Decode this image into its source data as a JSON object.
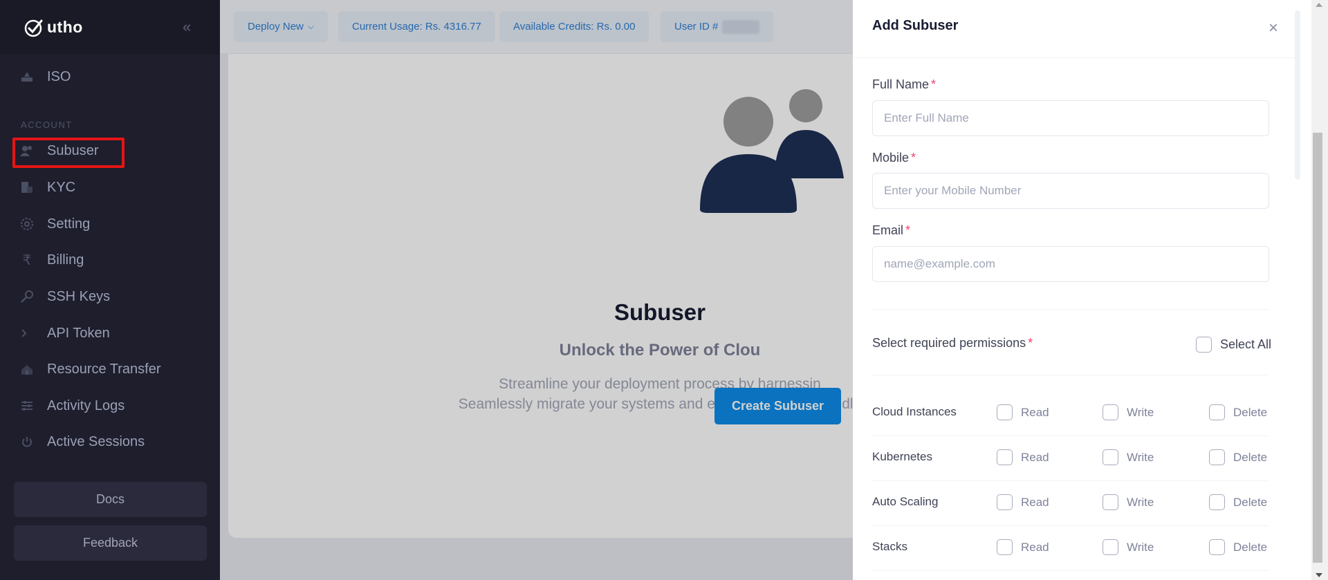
{
  "sidebar": {
    "brand": "utho",
    "collapse_icon": "double-chevron-left-icon",
    "section_account": "ACCOUNT",
    "items": [
      {
        "label": "ISO",
        "icon": "iso-icon"
      },
      {
        "label": "Subuser",
        "icon": "subuser-icon"
      },
      {
        "label": "KYC",
        "icon": "kyc-icon"
      },
      {
        "label": "Setting",
        "icon": "gear-icon"
      },
      {
        "label": "Billing",
        "icon": "rupee-icon"
      },
      {
        "label": "SSH Keys",
        "icon": "key-icon"
      },
      {
        "label": "API Token",
        "icon": "terminal-icon"
      },
      {
        "label": "Resource Transfer",
        "icon": "transfer-icon"
      },
      {
        "label": "Activity Logs",
        "icon": "sliders-icon"
      },
      {
        "label": "Active Sessions",
        "icon": "power-icon"
      }
    ],
    "docs_label": "Docs",
    "feedback_label": "Feedback"
  },
  "topbar": {
    "deploy_label": "Deploy New",
    "usage_label": "Current Usage: Rs. 4316.77",
    "credits_label": "Available Credits: Rs. 0.00",
    "userid_label": "User ID #"
  },
  "main": {
    "title": "Subuser",
    "subtitle": "Unlock the Power of Clou",
    "desc_line1": "Streamline your deployment process by harnessin",
    "desc_line2": "Seamlessly migrate your systems and explore a world of endle",
    "create_label": "Create Subuser"
  },
  "drawer": {
    "title": "Add Subuser",
    "full_name_label": "Full Name",
    "full_name_placeholder": "Enter Full Name",
    "mobile_label": "Mobile",
    "mobile_placeholder": "Enter your Mobile Number",
    "email_label": "Email",
    "email_placeholder": "name@example.com",
    "required_mark": "*",
    "permissions_label": "Select required permissions",
    "select_all_label": "Select All",
    "option_read": "Read",
    "option_write": "Write",
    "option_delete": "Delete",
    "permissions": [
      {
        "name": "Cloud Instances"
      },
      {
        "name": "Kubernetes"
      },
      {
        "name": "Auto Scaling"
      },
      {
        "name": "Stacks"
      }
    ]
  },
  "colors": {
    "sidebar_bg": "#1e1e2d",
    "accent": "#0d8ce9",
    "required": "#f1416c",
    "highlight_box": "#e51515"
  }
}
